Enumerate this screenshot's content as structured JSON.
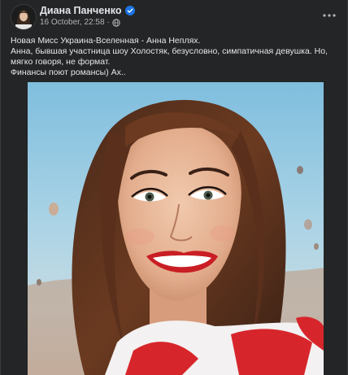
{
  "post": {
    "author": "Диана Панченко",
    "date": "16 October, 22:58",
    "separator": "·",
    "lines": [
      "Новая Мисс Украина-Вселенная - Анна Неплях.",
      "Анна, бывшая участница шоу Холостяк, безусловно, симпатичная девушка. Но, мягко говоря, не формат.",
      "Финансы поют романсы) Ах.."
    ]
  },
  "icons": {
    "verified": "verified-badge-icon",
    "privacy": "globe-icon",
    "menu": "more-options-icon"
  },
  "colors": {
    "background": "#242526",
    "text": "#e4e6eb",
    "secondary_text": "#b0b3b8",
    "verified": "#1b74e4"
  }
}
